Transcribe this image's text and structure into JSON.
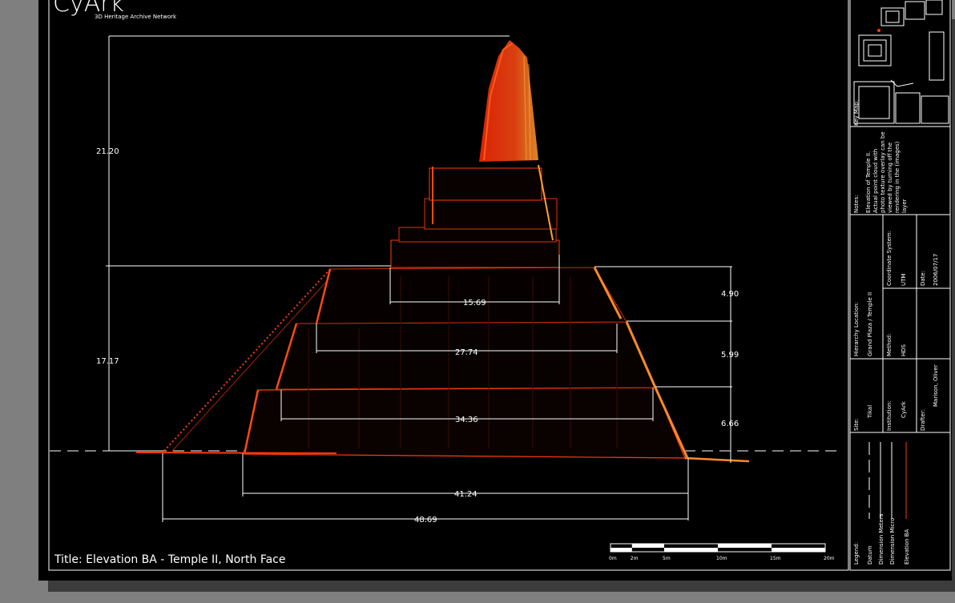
{
  "brand": {
    "logo_text": "CyArk",
    "subtitle": "3D Heritage Archive Network"
  },
  "title": "Title: Elevation BA - Temple II, North Face",
  "dimensions": {
    "overall_top": "21.20",
    "overall_bottom": "17.17",
    "right_top": "4.90",
    "right_mid": "5.99",
    "right_bottom": "6.66",
    "w1": "15.69",
    "w2": "27.74",
    "w3": "34.36",
    "w4": "41.24",
    "w5": "48.69"
  },
  "scale_bar": {
    "labels": [
      "0m",
      "2m",
      "5m",
      "10m",
      "15m",
      "20m"
    ],
    "values": [
      0,
      2,
      5,
      10,
      15,
      20
    ]
  },
  "title_block": {
    "key_map_label": "Key Map:",
    "notes_label": "Notes:",
    "notes_text": [
      "Elevation of Temple II.",
      "Actual point cloud with",
      "photo texture overlay can be",
      "viewed by turning off the",
      "rendering in the (images)",
      "layer"
    ],
    "site_label": "Site:",
    "site_value": "Tikal",
    "hierarchy_label": "Hierarchy Location:",
    "hierarchy_value": "Grand Plaza / Temple II",
    "coordinate_label": "Coordinate System:",
    "coordinate_value": "UTM",
    "institution_label": "Institution:",
    "institution_value": "CyArk",
    "method_label": "Method:",
    "method_value": "HDS",
    "date_label": "Date:",
    "date_value": "2006/07/17",
    "drafter_label": "Drafter:",
    "drafter_value": "Marison, Oliver",
    "legend_label": "Legend:",
    "legend_items": [
      "Datum",
      "Dimension Meters",
      "Dimension Micro",
      "Elevation BA"
    ]
  },
  "colors": {
    "elevation": "#ff3a10",
    "elevation_hot": "#ff7a20",
    "line": "#ffffff",
    "sheet": "#000000",
    "paper": "#7f7f7f"
  }
}
